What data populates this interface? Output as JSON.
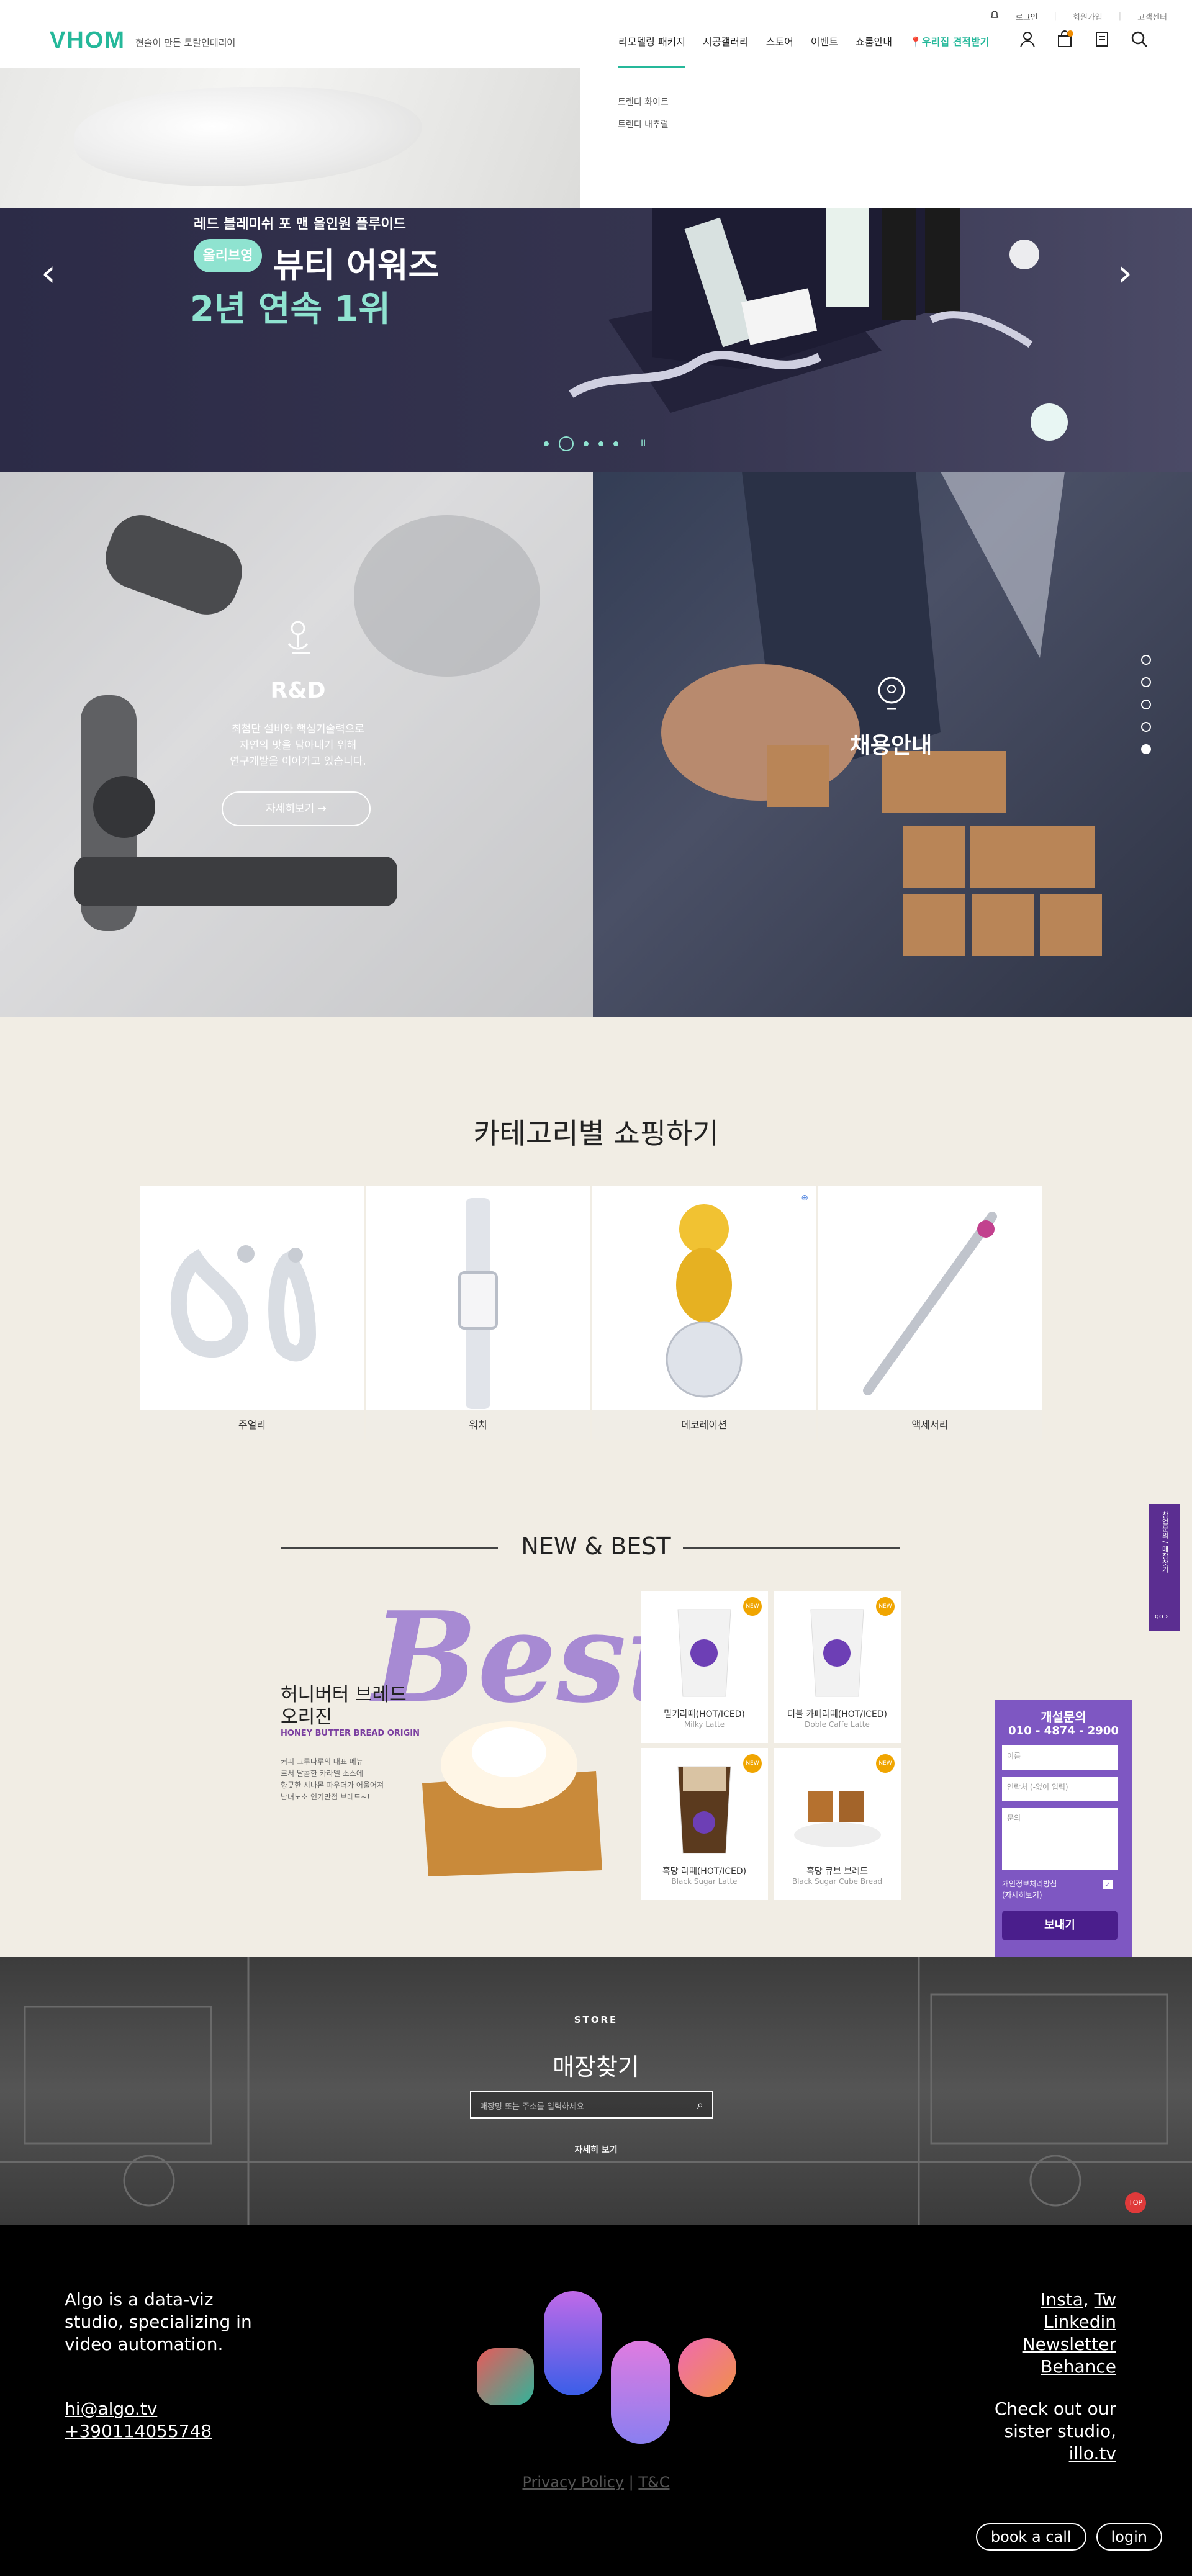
{
  "header": {
    "logo": "VHOM",
    "tagline": "현솔이 만든 토탈인테리어",
    "top_links": [
      "로그인",
      "회원가입",
      "고객센터"
    ],
    "nav": [
      "리모델링 패키지",
      "시공갤러리",
      "스토어",
      "이벤트",
      "쇼룸안내",
      "우리집 견적받기"
    ],
    "submenu": [
      "트렌디 화이트",
      "트렌디 내추럴"
    ]
  },
  "hero": {
    "eyebrow": "레드 블레미쉬 포 맨 올인원 플루이드",
    "badge": "올리브영",
    "title_line1": "뷰티 어워즈",
    "title_line2": "2년 연속 1위",
    "prev": "‹",
    "next": "›",
    "pause": "II"
  },
  "rd": {
    "title": "R&D",
    "text": "최첨단 설비와 핵심기술력으로\n자연의 맛을 담아내기 위해\n연구개발을 이어가고 있습니다.",
    "button": "자세히보기 →"
  },
  "recruit": {
    "title": "채용안내"
  },
  "category": {
    "title": "카테고리별 쇼핑하기",
    "items": [
      "주얼리",
      "워치",
      "데코레이션",
      "액세서리"
    ]
  },
  "newbest": {
    "title": "NEW & BEST",
    "big_word": "Best",
    "product_name": "허니버터 브레드\n오리진",
    "product_en": "HONEY BUTTER BREAD ORIGIN",
    "desc": "커피 그루나루의 대표 메뉴\n로서 달콤한 카라멜 소스에\n향긋한 시나몬 파우더가 어울어져\n남녀노소 인기만점 브레드~!",
    "products": [
      {
        "name": "밀키라떼(HOT/ICED)",
        "en": "Milky Latte",
        "badge": "NEW"
      },
      {
        "name": "더블 카페라떼(HOT/ICED)",
        "en": "Doble Caffe Latte",
        "badge": "NEW"
      },
      {
        "name": "흑당 라떼(HOT/ICED)",
        "en": "Black Sugar Latte",
        "badge": "NEW"
      },
      {
        "name": "흑당 큐브 브레드",
        "en": "Black Sugar Cube Bread",
        "badge": "NEW"
      }
    ]
  },
  "form": {
    "title": "개설문의",
    "phone": "010 - 4874 - 2900",
    "name_placeholder": "이름",
    "contact_placeholder": "연락처 (-없이 입력)",
    "message_placeholder": "문의",
    "agree": "개인정보처리방침\n(자세히보기)",
    "submit": "보내기"
  },
  "sidetab": {
    "label": "창업문의 / 매장찾기",
    "go": "go ›"
  },
  "store": {
    "label": "STORE",
    "title": "매장찾기",
    "search_placeholder": "매장명 또는 주소를 입력하세요",
    "more": "자세히 보기",
    "top": "TOP"
  },
  "footer": {
    "about": "Algo is a data-viz studio, specializing in video automation.",
    "email": "hi@algo.tv",
    "phone": "+390114055748",
    "social": [
      "Insta",
      "Tw",
      "Linkedin",
      "Newsletter",
      "Behance"
    ],
    "sister_text": "Check out our sister studio,",
    "sister_link": "illo.tv",
    "privacy": "Privacy Policy",
    "terms": "T&C",
    "book": "book a call",
    "login": "login"
  },
  "colors": {
    "brand": "#25b89a",
    "purple": "#7e57c2",
    "beige": "#f1ede4"
  }
}
